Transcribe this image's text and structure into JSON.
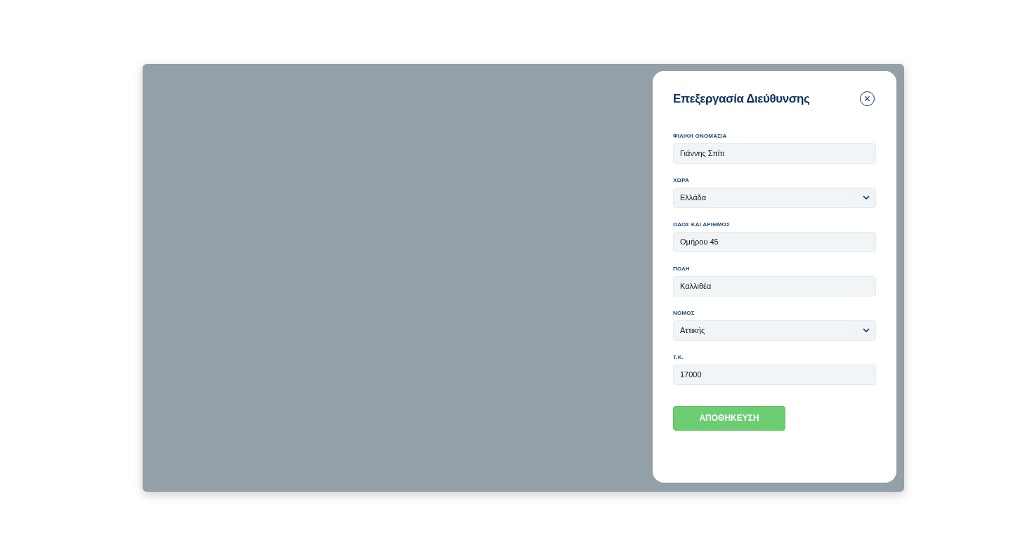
{
  "dialog": {
    "title": "Επεξεργασία Διεύθυνσης",
    "close_icon": "×"
  },
  "fields": [
    {
      "label": "ΦΙΛΙΚΗ ΟΝΟΜΑΣΙΑ",
      "kind": "text",
      "value": "Γιάννης Σπίτι"
    },
    {
      "label": "ΧΩΡΑ",
      "kind": "select",
      "value": "Ελλάδα"
    },
    {
      "label": "ΟΔΟΣ ΚΑΙ ΑΡΙΘΜΟΣ",
      "kind": "text",
      "value": "Ομήρου 45"
    },
    {
      "label": "ΠΟΛΗ",
      "kind": "text",
      "value": "Καλλιθέα"
    },
    {
      "label": "ΝΟΜΟΣ",
      "kind": "select",
      "value": "Αττικής"
    },
    {
      "label": "Τ.Κ.",
      "kind": "text",
      "value": "17000"
    }
  ],
  "save_button": "ΑΠΟΘΗΚΕΥΣΗ"
}
